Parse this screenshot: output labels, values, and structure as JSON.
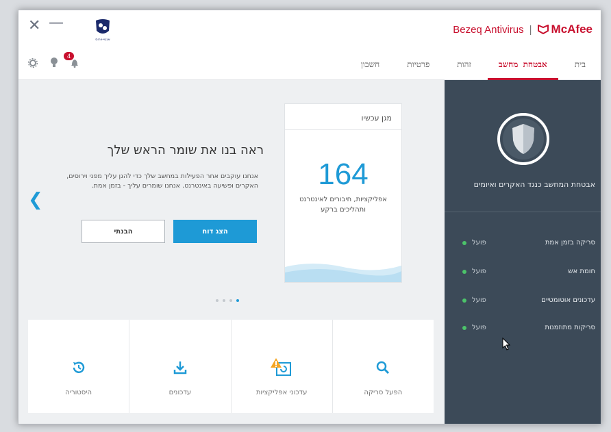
{
  "window": {
    "brand": {
      "name": "Bezeq Antivirus",
      "separator": "|",
      "vendor": "McAfee"
    },
    "logo_caption": "אנטי-וירוס"
  },
  "nav": {
    "notification_count": "4",
    "tabs": [
      {
        "label": "בית",
        "active": false
      },
      {
        "label": "אבטחת מחשב",
        "active": true
      },
      {
        "label": "זהות",
        "active": false
      },
      {
        "label": "פרטיות",
        "active": false
      },
      {
        "label": "חשבון",
        "active": false
      }
    ]
  },
  "card": {
    "title": "מגן עכשיו",
    "number": "164",
    "description": "אפליקציות, חיבורים לאינטרנט ותהליכים ברקע"
  },
  "hero": {
    "headline": "ראה בנו את שומר הראש שלך",
    "subtext": "אנחנו עוקבים אחר הפעילות במחשב שלך כדי להגן עליך מפני וירוסים, האקרים ופשיעה באינטרנט. אנחנו שומרים עליך - בזמן אמת.",
    "primary_button": "הצג דוח",
    "secondary_button": "הבנתי"
  },
  "tiles": [
    {
      "label": "היסטוריה",
      "icon": "history-icon"
    },
    {
      "label": "עדכונים",
      "icon": "download-icon"
    },
    {
      "label": "עדכוני אפליקציות",
      "icon": "app-update-warning-icon"
    },
    {
      "label": "הפעל סריקה",
      "icon": "search-icon"
    }
  ],
  "sidebar": {
    "title": "אבטחת המחשב כנגד האקרים ואיומים",
    "statuses": [
      {
        "name": "סריקה בזמן אמת",
        "value": "פועל"
      },
      {
        "name": "חומת אש",
        "value": "פועל"
      },
      {
        "name": "עדכונים אוטומטיים",
        "value": "פועל"
      },
      {
        "name": "סריקות מתוזמנות",
        "value": "פועל"
      }
    ]
  },
  "colors": {
    "brand_red": "#c8102e",
    "accent_blue": "#1e9ad6",
    "sidebar_bg": "#3c4a58",
    "status_green": "#4cc36a"
  }
}
